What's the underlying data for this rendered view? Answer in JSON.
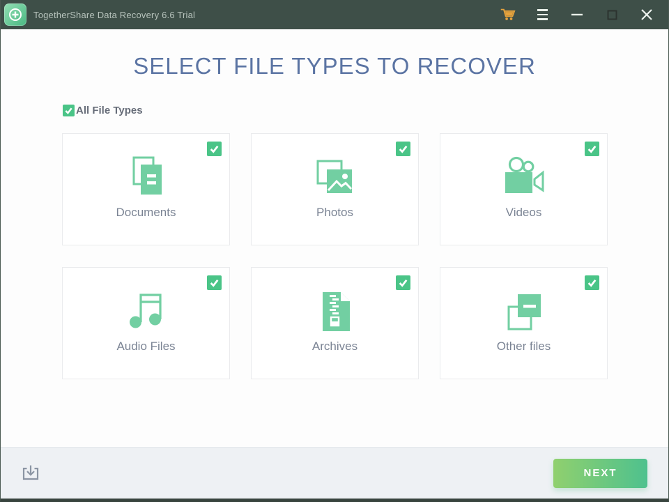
{
  "titlebar": {
    "app_title": "TogetherShare Data Recovery 6.6 Trial",
    "icons": {
      "cart": "shopping-cart",
      "menu": "hamburger-menu",
      "minimize": "minimize",
      "maximize": "maximize",
      "close": "close"
    }
  },
  "main": {
    "heading": "SELECT FILE TYPES TO RECOVER",
    "all_file_types": {
      "label": "All File Types",
      "checked": true
    }
  },
  "cards": [
    {
      "label": "Documents",
      "icon": "documents-icon",
      "checked": true
    },
    {
      "label": "Photos",
      "icon": "photos-icon",
      "checked": true
    },
    {
      "label": "Videos",
      "icon": "videos-icon",
      "checked": true
    },
    {
      "label": "Audio Files",
      "icon": "audio-files-icon",
      "checked": true
    },
    {
      "label": "Archives",
      "icon": "archives-icon",
      "checked": true
    },
    {
      "label": "Other files",
      "icon": "other-files-icon",
      "checked": true
    }
  ],
  "footer": {
    "next_button": "NEXT",
    "download_icon": "download"
  },
  "colors": {
    "titlebar_bg": "#3e4f48",
    "heading_blue": "#5b74a3",
    "accent_green": "#4ac487",
    "icon_green": "#72cfa2",
    "button_gradient_start": "#90d06e",
    "button_gradient_end": "#4ec18e",
    "cart_orange": "#e6a23c",
    "footer_bg": "#eef1f4"
  }
}
